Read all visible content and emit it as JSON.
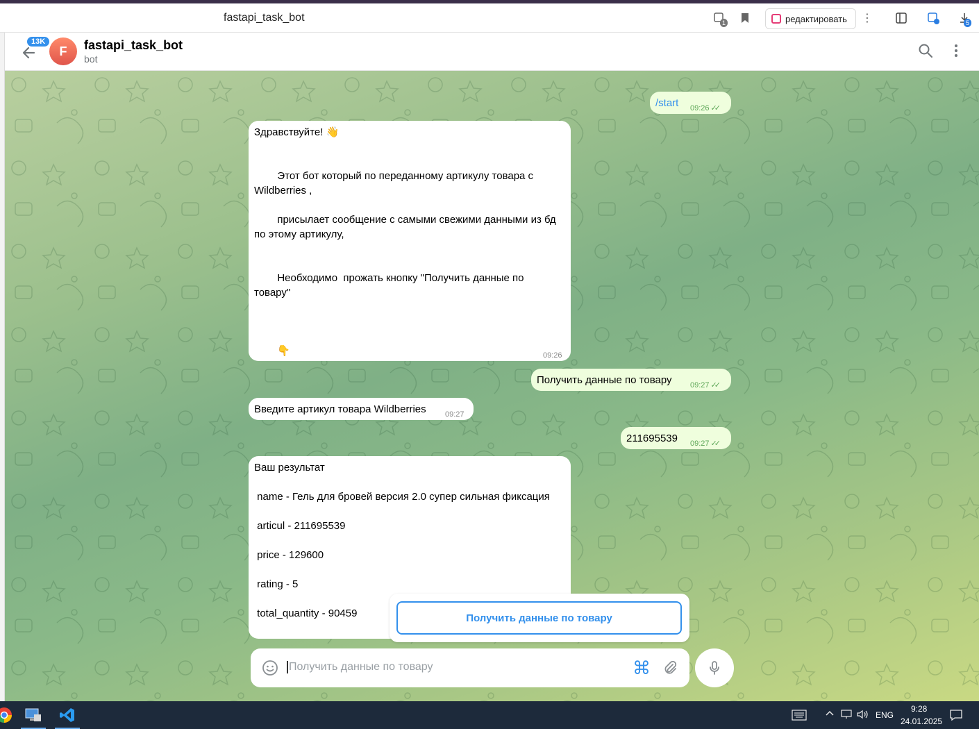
{
  "browser": {
    "tab_title": "fastapi_task_bot",
    "edit_label": "редактировать",
    "ext_badge_1": "1",
    "ext_badge_5": "5"
  },
  "header": {
    "unread_count": "13K",
    "avatar_letter": "F",
    "title": "fastapi_task_bot",
    "subtitle": "bot"
  },
  "messages": [
    {
      "dir": "out",
      "text": "/start",
      "time": "09:26"
    },
    {
      "dir": "in",
      "text": "Здравствуйте! 👋\n\n\n        Этот бот который по переданному артикулу товара с Wildberries ,\n\n        присылает сообщение с самыми свежими данными из бд по этому артикулу,\n\n\n        Необходимо  прожать кнопку \"Получить данные по товару\"\n\n\n\n        👇",
      "time": "09:26"
    },
    {
      "dir": "out",
      "text": "Получить данные по товару",
      "time": "09:27"
    },
    {
      "dir": "in",
      "text": "Введите артикул товара Wildberries",
      "time": "09:27"
    },
    {
      "dir": "out",
      "text": "211695539",
      "time": "09:27"
    },
    {
      "dir": "in",
      "text": "Ваш результат\n\n name - Гель для бровей версия 2.0 супер сильная фиксация\n\n articul - 211695539\n\n price - 129600\n\n rating - 5\n\n total_quantity - 90459"
    }
  ],
  "keyboard": {
    "button_label": "Получить данные по товару"
  },
  "composer": {
    "placeholder": "Получить данные по товару"
  },
  "taskbar": {
    "lang": "ENG",
    "time": "9:28",
    "date": "24.01.2025"
  },
  "colors": {
    "accent": "#3390ec",
    "outgoing_bubble": "#effedd",
    "incoming_bubble": "#ffffff",
    "read_ticks": "#5ea758",
    "avatar": "#e0554b",
    "taskbar": "#1d2a3b"
  },
  "icons": [
    "back-arrow-icon",
    "search-icon",
    "more-vertical-icon",
    "emoji-icon",
    "bot-command-icon",
    "attach-icon",
    "microphone-icon"
  ]
}
